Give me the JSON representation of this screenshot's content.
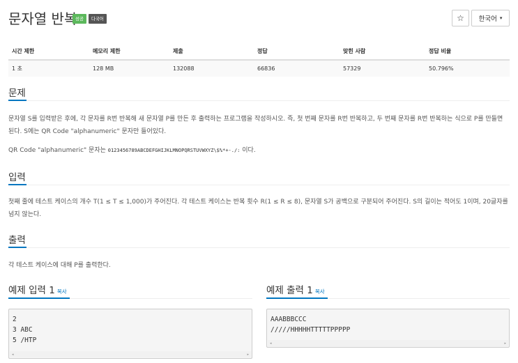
{
  "problem": {
    "title": "문자열 반복",
    "badges": {
      "success": "성공",
      "multilang": "다국어"
    }
  },
  "controls": {
    "star_icon": "☆",
    "language": "한국어",
    "caret": "▾"
  },
  "info_table": {
    "headers": [
      "시간 제한",
      "메모리 제한",
      "제출",
      "정답",
      "맞힌 사람",
      "정답 비율"
    ],
    "values": [
      "1 초",
      "128 MB",
      "132088",
      "66836",
      "57329",
      "50.796%"
    ]
  },
  "sections": {
    "description": {
      "title": "문제",
      "para1": "문자열 S를 입력받은 후에, 각 문자를 R번 반복해 새 문자열 P를 만든 후 출력하는 프로그램을 작성하시오. 즉, 첫 번째 문자를 R번 반복하고, 두 번째 문자를 R번 반복하는 식으로 P를 만들면 된다. S에는 QR Code \"alphanumeric\" 문자만 들어있다.",
      "para2_prefix": "QR Code \"alphanumeric\" 문자는 ",
      "para2_code": "0123456789ABCDEFGHIJKLMNOPQRSTUVWXYZ\\$%*+-./:",
      "para2_suffix": " 이다."
    },
    "input": {
      "title": "입력",
      "text": "첫째 줄에 테스트 케이스의 개수 T(1 ≤ T ≤ 1,000)가 주어진다. 각 테스트 케이스는 반복 횟수 R(1 ≤ R ≤ 8), 문자열 S가 공백으로 구분되어 주어진다. S의 길이는 적어도 1이며, 20글자를 넘지 않는다."
    },
    "output": {
      "title": "출력",
      "text": "각 테스트 케이스에 대해 P를 출력한다."
    }
  },
  "samples": {
    "input": {
      "title": "예제 입력 1",
      "copy": "복사",
      "content": "2\n3 ABC\n5 /HTP"
    },
    "output": {
      "title": "예제 출력 1",
      "copy": "복사",
      "content": "AAABBBCCC\n/////HHHHHTTTTTPPPPP"
    },
    "scroll_left": "◂",
    "scroll_right": "▸"
  }
}
